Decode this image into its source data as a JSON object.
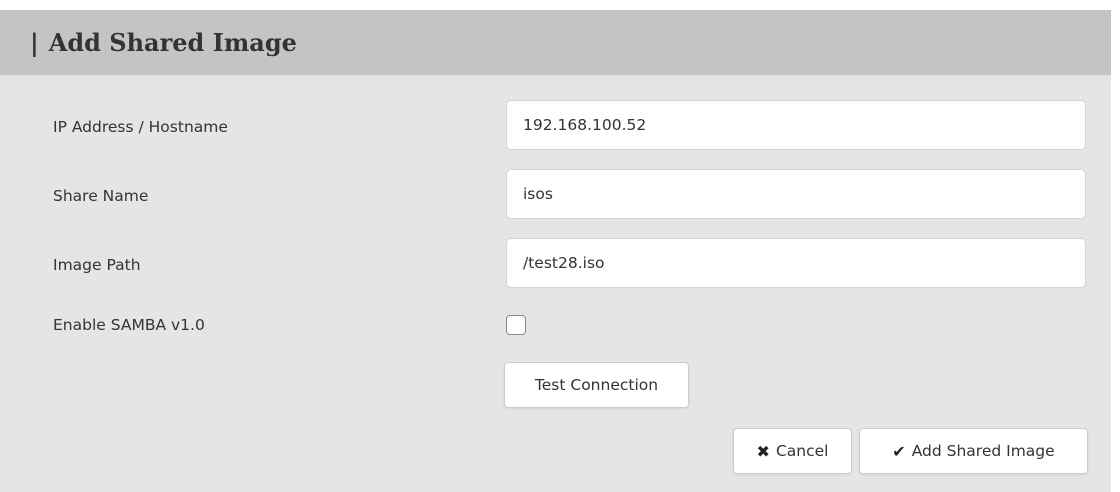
{
  "dialog": {
    "title_prefix": "|",
    "title": "Add Shared Image"
  },
  "form": {
    "ip_label": "IP Address / Hostname",
    "ip_value": "192.168.100.52",
    "share_label": "Share Name",
    "share_value": "isos",
    "path_label": "Image Path",
    "path_value": "/test28.iso",
    "samba_label": "Enable SAMBA v1.0",
    "samba_checked": false
  },
  "buttons": {
    "test_connection": "Test Connection",
    "cancel": "Cancel",
    "cancel_icon": "✖",
    "add": "Add Shared Image",
    "add_icon": "✔"
  },
  "icons": {
    "cancel_icon_name": "x-mark-icon",
    "add_icon_name": "checkmark-icon"
  },
  "colors": {
    "header_bg": "#c4c4c4",
    "panel_bg": "#e5e5e5",
    "text": "#333333"
  }
}
